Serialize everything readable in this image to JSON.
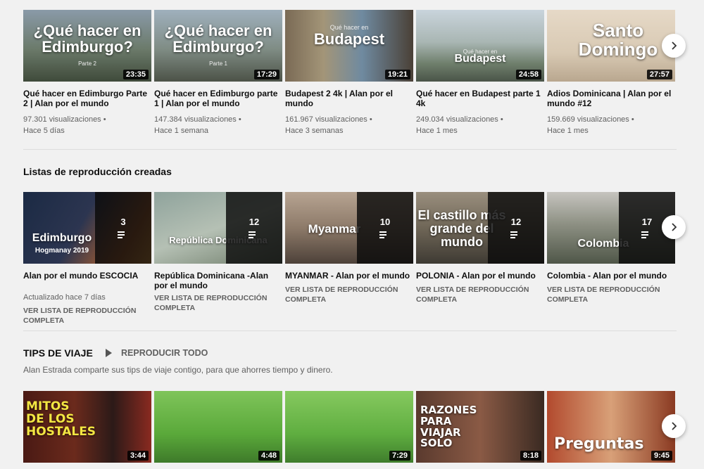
{
  "row1": {
    "videos": [
      {
        "title": "Qué hacer en Edimburgo Parte 2 | Alan por el mundo",
        "views": "97.301 visualizaciones •",
        "age": "Hace 5 días",
        "duration": "23:35",
        "thumb_text": "¿Qué hacer en Edimburgo?",
        "thumb_small": "Parte 2"
      },
      {
        "title": "Qué hacer en Edimburgo parte 1 | Alan por el mundo",
        "views": "147.384 visualizaciones •",
        "age": "Hace 1 semana",
        "duration": "17:29",
        "thumb_text": "¿Qué hacer en Edimburgo?",
        "thumb_small": "Parte 1"
      },
      {
        "title": "Budapest 2 4k | Alan por el mundo",
        "views": "161.967 visualizaciones •",
        "age": "Hace 3 semanas",
        "duration": "19:21",
        "thumb_text": "Budapest",
        "thumb_small": "Qué hacer en"
      },
      {
        "title": "Qué hacer en Budapest parte 1 4k",
        "views": "249.034 visualizaciones •",
        "age": "Hace 1 mes",
        "duration": "24:58",
        "thumb_text": "Budapest",
        "thumb_small": "Qué hacer en"
      },
      {
        "title": "Adios Dominicana | Alan por el mundo #12",
        "views": "159.669 visualizaciones •",
        "age": "Hace 1 mes",
        "duration": "27:57",
        "thumb_text": "Santo Domingo",
        "thumb_small": ""
      }
    ]
  },
  "playlists_section": {
    "title": "Listas de reproducción creadas",
    "playlists": [
      {
        "title": "Alan por el mundo ESCOCIA",
        "meta": "Actualizado hace 7 días",
        "count": "3",
        "link": "VER LISTA DE REPRODUCCIÓN COMPLETA",
        "thumb_text": "Edimburgo",
        "thumb_small": "Hogmanay 2019"
      },
      {
        "title": "República Dominicana -Alan por el mundo",
        "meta": "",
        "count": "12",
        "link": "VER LISTA DE REPRODUCCIÓN COMPLETA",
        "thumb_text": "República Dominicana",
        "thumb_small": ""
      },
      {
        "title": "MYANMAR - Alan por el mundo",
        "meta": "",
        "count": "10",
        "link": "VER LISTA DE REPRODUCCIÓN COMPLETA",
        "thumb_text": "Myanmar",
        "thumb_small": ""
      },
      {
        "title": "POLONIA - Alan por el mundo",
        "meta": "",
        "count": "12",
        "link": "VER LISTA DE REPRODUCCIÓN COMPLETA",
        "thumb_text": "El castillo más grande del mundo",
        "thumb_small": ""
      },
      {
        "title": "Colombia - Alan por el mundo",
        "meta": "",
        "count": "17",
        "link": "VER LISTA DE REPRODUCCIÓN COMPLETA",
        "thumb_text": "Colombia",
        "thumb_small": ""
      }
    ]
  },
  "tips_section": {
    "title": "TIPS DE VIAJE",
    "play_all": "REPRODUCIR TODO",
    "description": "Alan Estrada comparte sus tips de viaje contigo, para que ahorres tiempo y dinero.",
    "videos": [
      {
        "duration": "3:44",
        "thumb_text": "MITOS DE LOS HOSTALES"
      },
      {
        "duration": "4:48",
        "thumb_text": ""
      },
      {
        "duration": "7:29",
        "thumb_text": ""
      },
      {
        "duration": "8:18",
        "thumb_text": "RAZONES PARA VIAJAR SOLO"
      },
      {
        "duration": "9:45",
        "thumb_text": "Preguntas"
      }
    ]
  },
  "icons": {
    "next_arrow": "chevron-right-icon",
    "playlist": "playlist-icon",
    "play": "play-icon"
  }
}
